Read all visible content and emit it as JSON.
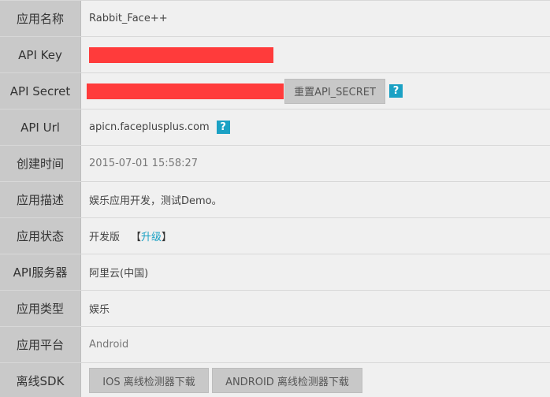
{
  "rows": {
    "app_name": {
      "label": "应用名称",
      "value": "Rabbit_Face++"
    },
    "api_key": {
      "label": "API Key"
    },
    "api_secret": {
      "label": "API Secret",
      "reset_button": "重置API_SECRET",
      "help": "?"
    },
    "api_url": {
      "label": "API Url",
      "value": "apicn.faceplusplus.com",
      "help": "?"
    },
    "created_time": {
      "label": "创建时间",
      "value": "2015-07-01 15:58:27"
    },
    "description": {
      "label": "应用描述",
      "value": "娱乐应用开发，测试Demo。"
    },
    "status": {
      "label": "应用状态",
      "value": "开发版",
      "bracket_open": "【",
      "upgrade": "升级",
      "bracket_close": "】"
    },
    "server": {
      "label": "API服务器",
      "value": "阿里云(中国)"
    },
    "app_type": {
      "label": "应用类型",
      "value": "娱乐"
    },
    "platform": {
      "label": "应用平台",
      "value": "Android"
    },
    "sdk": {
      "label": "离线SDK",
      "ios_button": "IOS 离线检测器下载",
      "android_button": "ANDROID 离线检测器下载"
    }
  },
  "colors": {
    "label_bg": "#c9c9c9",
    "value_bg": "#f0f0f0",
    "redaction": "#ff3b3b",
    "accent": "#1ba1c4",
    "button_bg": "#c8c8c8"
  }
}
